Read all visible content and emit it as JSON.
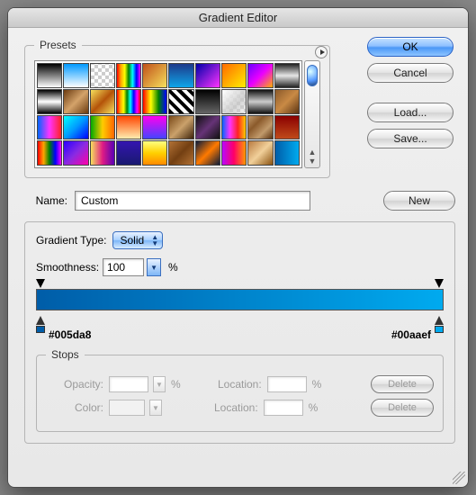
{
  "window": {
    "title": "Gradient Editor"
  },
  "buttons": {
    "ok": "OK",
    "cancel": "Cancel",
    "load": "Load...",
    "save": "Save...",
    "new": "New",
    "delete": "Delete"
  },
  "presets": {
    "legend": "Presets",
    "swatches": [
      "linear-gradient(#000,#fff)",
      "linear-gradient(#09f,#fff)",
      "repeating-conic-gradient(#ccc 0 25%, #fff 0 50%) 0/8px 8px",
      "linear-gradient(90deg,red,orange,yellow,green,cyan,blue,magenta)",
      "linear-gradient(135deg,#c0501a,#f6e05c)",
      "linear-gradient(#1e3a8a,#0ea5e9)",
      "linear-gradient(135deg,#00a,#f3f)",
      "linear-gradient(135deg,#ff6a00,#ffee00)",
      "linear-gradient(135deg,#6a00ff,#ea00ff,#ffae00)",
      "linear-gradient(#222,#e6e6e6,#222)",
      "linear-gradient(#000,#fff,#000)",
      "linear-gradient(135deg,#6b3a10,#d4a36a,#6b3a10)",
      "linear-gradient(135deg,#f6e05c,#b45309,#f6e05c)",
      "linear-gradient(90deg,red,orange,yellow,green,cyan,blue,magenta,red)",
      "linear-gradient(90deg,red,yellow,green,blue)",
      "repeating-linear-gradient(45deg,#000 0 4px,#fff 4px 8px)",
      "linear-gradient(#000,#666)",
      "linear-gradient(135deg,#ffffff 0%, rgba(200,200,200,0.8) 60%, rgba(220,220,220,0.3) 100%), repeating-conic-gradient(#ccc 0 25%, #fff 0 50%) 0/8px 8px",
      "linear-gradient(#111,#ccc,#111)",
      "linear-gradient(135deg,#8b5a2b,#c98a45,#5b3413)",
      "linear-gradient(90deg,#06f,#f3f,#f22)",
      "linear-gradient(135deg,#0ff,#09f,#00f)",
      "linear-gradient(90deg,#0a0,#fc0,#f60)",
      "linear-gradient(#ff4500,#ffedb0)",
      "linear-gradient(#f0e,#44f)",
      "linear-gradient(135deg,#7a4a19,#caa16b,#3e240b)",
      "linear-gradient(135deg,#111,#637,#111)",
      "linear-gradient(90deg,#06f,#f3f,#f22,#fc0)",
      "linear-gradient(135deg,#c19a6b,#8b5a2b,#c19a6b,#5a3210)",
      "linear-gradient(#8b0000,#c04a1a)",
      "linear-gradient(90deg,red,orange,green,blue,magenta)",
      "linear-gradient(135deg,#2a00ff,#8a2be2,#ff00a8)",
      "linear-gradient(90deg,#f6e05c,#e01b84,#5a00b5)",
      "linear-gradient(#3415b0,#191970)",
      "linear-gradient(#ffff80,#ffd000,#ff8a00)",
      "linear-gradient(135deg,#b27235,#733f12,#b27235)",
      "linear-gradient(135deg,#0b1b3b,#ff7a00,#0b1b3b)",
      "linear-gradient(90deg,#b906ff,#f06,#f90)",
      "linear-gradient(135deg,#b97a40,#f1d09a,#8a5210)",
      "linear-gradient(90deg,#005da8,#00aaef)"
    ]
  },
  "name": {
    "label": "Name:",
    "value": "Custom"
  },
  "gradient": {
    "type_label": "Gradient Type:",
    "type_value": "Solid",
    "smoothness_label": "Smoothness:",
    "smoothness_value": "100",
    "smoothness_unit": "%",
    "bar_css": "linear-gradient(90deg,#005da8,#00aaef)",
    "left_hex": "#005da8",
    "right_hex": "#00aaef"
  },
  "stops": {
    "legend": "Stops",
    "opacity_label": "Opacity:",
    "color_label": "Color:",
    "location_label": "Location:",
    "unit": "%"
  }
}
